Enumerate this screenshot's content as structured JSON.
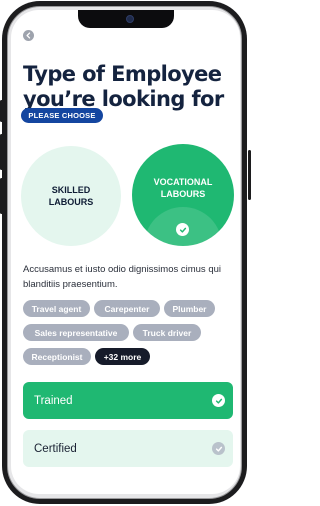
{
  "screen": {
    "title_line1": "Type of Employee",
    "title_line2": "you’re looking for",
    "pill_label": "PLEASE CHOOSE"
  },
  "categories": [
    {
      "line1": "SKILLED",
      "line2": "LABOURS",
      "selected": false
    },
    {
      "line1": "VOCATIONAL",
      "line2": "LABOURS",
      "selected": true
    }
  ],
  "description": "Accusamus et iusto odio dignissimos cimus qui blanditiis praesentium.",
  "chips": [
    {
      "label": "Travel agent"
    },
    {
      "label": "Carepenter"
    },
    {
      "label": "Plumber"
    },
    {
      "label": "Sales representative"
    },
    {
      "label": "Truck driver"
    },
    {
      "label": "Receptionist"
    },
    {
      "label": "+32 more"
    }
  ],
  "options": [
    {
      "label": "Trained",
      "selected": true
    },
    {
      "label": "Certified",
      "selected": false
    }
  ],
  "colors": {
    "accent_green": "#1fb872",
    "light_green": "#e4f6ee",
    "pill_blue": "#1446a0",
    "title_navy": "#14233f",
    "chip_gray": "#a9afbd",
    "chip_dark": "#161b2a"
  },
  "icons": {
    "back": "chevron-left-icon",
    "check": "check-icon"
  }
}
